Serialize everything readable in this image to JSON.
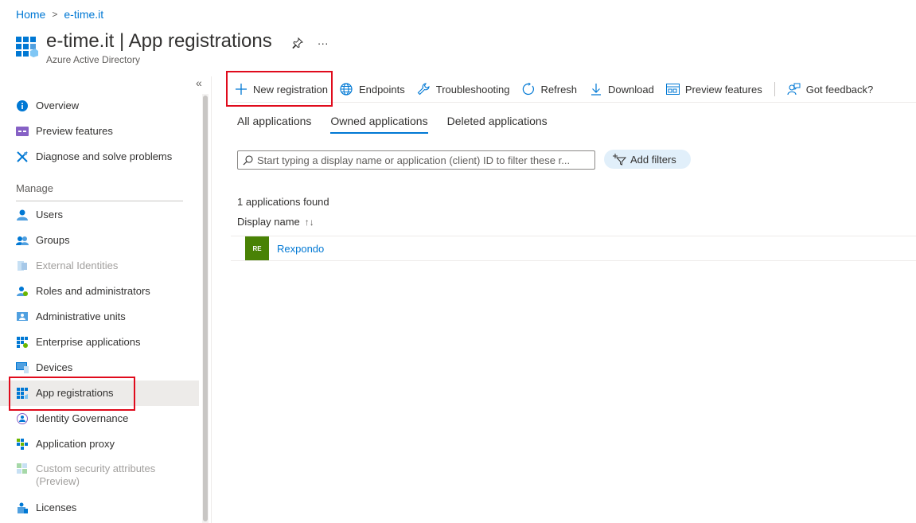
{
  "breadcrumb": {
    "home": "Home",
    "current": "e-time.it"
  },
  "header": {
    "title": "e-time.it | App registrations",
    "subtitle": "Azure Active Directory"
  },
  "sidebar": {
    "top_items": [
      {
        "label": "Overview",
        "icon": "info-icon"
      },
      {
        "label": "Preview features",
        "icon": "preview-features-icon"
      },
      {
        "label": "Diagnose and solve problems",
        "icon": "wrench-icon"
      }
    ],
    "section_label": "Manage",
    "manage_items": [
      {
        "label": "Users",
        "icon": "user-icon"
      },
      {
        "label": "Groups",
        "icon": "groups-icon"
      },
      {
        "label": "External Identities",
        "icon": "external-identities-icon"
      },
      {
        "label": "Roles and administrators",
        "icon": "roles-icon"
      },
      {
        "label": "Administrative units",
        "icon": "admin-units-icon"
      },
      {
        "label": "Enterprise applications",
        "icon": "enterprise-apps-icon"
      },
      {
        "label": "Devices",
        "icon": "devices-icon"
      },
      {
        "label": "App registrations",
        "icon": "app-registrations-icon"
      },
      {
        "label": "Identity Governance",
        "icon": "identity-governance-icon"
      },
      {
        "label": "Application proxy",
        "icon": "application-proxy-icon"
      },
      {
        "label": "Custom security attributes",
        "label2": "(Preview)",
        "icon": "custom-security-icon"
      },
      {
        "label": "Licenses",
        "icon": "licenses-icon"
      }
    ]
  },
  "toolbar": {
    "new_registration": "New registration",
    "endpoints": "Endpoints",
    "troubleshooting": "Troubleshooting",
    "refresh": "Refresh",
    "download": "Download",
    "preview_features": "Preview features",
    "feedback": "Got feedback?"
  },
  "tabs": [
    "All applications",
    "Owned applications",
    "Deleted applications"
  ],
  "active_tab": "Owned applications",
  "search": {
    "placeholder": "Start typing a display name or application (client) ID to filter these r..."
  },
  "add_filters": "Add filters",
  "results": {
    "count_text": "1 applications found",
    "column_display_name": "Display name",
    "sort_glyph": "↑↓"
  },
  "apps": [
    {
      "initials": "RE",
      "name": "Rexpondo"
    }
  ],
  "colors": {
    "accent": "#0078d4",
    "highlight": "#e00b1c",
    "avatar": "#498205"
  }
}
